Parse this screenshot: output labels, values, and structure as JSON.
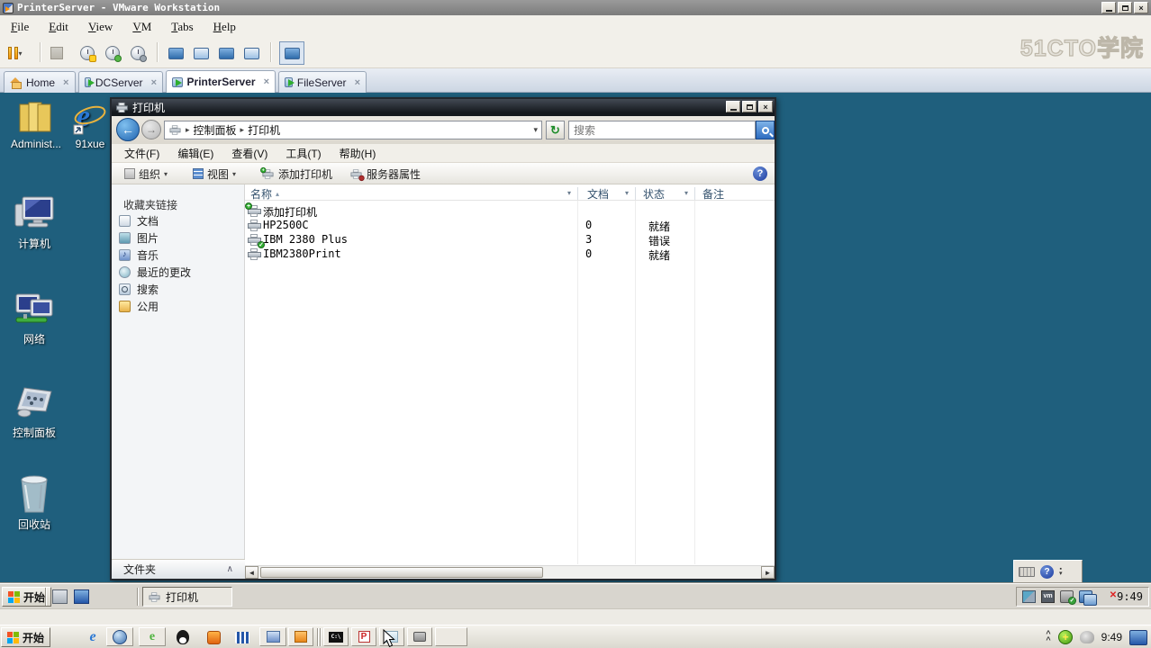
{
  "vmware": {
    "title": "PrinterServer - VMware Workstation",
    "menu_items": [
      "File",
      "Edit",
      "View",
      "VM",
      "Tabs",
      "Help"
    ],
    "toolbar_icons": [
      "pause-icon",
      "ctrl-alt-del-icon",
      "snapshot-take-icon",
      "snapshot-revert-icon",
      "snapshot-manager-icon",
      "console-view-icon",
      "unity-view-icon",
      "fullscreen-icon",
      "show-console-icon",
      "library-toggle-icon"
    ],
    "tabs": [
      {
        "label": "Home"
      },
      {
        "label": "DCServer"
      },
      {
        "label": "PrinterServer"
      },
      {
        "label": "FileServer"
      }
    ],
    "watermark": "51CTO学院"
  },
  "desktop": {
    "bg_color": "#1F5F7D",
    "icons": [
      {
        "label": "Administ..."
      },
      {
        "label": "91xue"
      },
      {
        "label": "计算机"
      },
      {
        "label": "网络"
      },
      {
        "label": "控制面板"
      },
      {
        "label": "回收站"
      }
    ]
  },
  "printer_window": {
    "title": "打印机",
    "breadcrumb": {
      "segment1": "控制面板",
      "segment2": "打印机"
    },
    "search": {
      "placeholder": "搜索"
    },
    "menu_items": [
      "文件(F)",
      "编辑(E)",
      "查看(V)",
      "工具(T)",
      "帮助(H)"
    ],
    "commands": {
      "organize": "组织",
      "views": "视图",
      "add_printer": "添加打印机",
      "server_properties": "服务器属性"
    },
    "sidebar": {
      "header": "收藏夹链接",
      "items": [
        "文档",
        "图片",
        "音乐",
        "最近的更改",
        "搜索",
        "公用"
      ],
      "footer": "文件夹"
    },
    "columns": [
      "名称",
      "文档",
      "状态",
      "备注"
    ],
    "rows": [
      {
        "name": "添加打印机",
        "documents": "",
        "status": "",
        "remark": ""
      },
      {
        "name": "HP2500C",
        "documents": "0",
        "status": "就绪",
        "remark": ""
      },
      {
        "name": "IBM 2380 Plus",
        "documents": "3",
        "status": "错误",
        "remark": ""
      },
      {
        "name": "IBM2380Print",
        "documents": "0",
        "status": "就绪",
        "remark": ""
      }
    ]
  },
  "language_bar": {
    "icons": [
      "keyboard-icon",
      "help-icon",
      "options-icon"
    ]
  },
  "guest_taskbar": {
    "start_label": "开始",
    "quicklaunch_icons": [
      "server-manager-icon",
      "show-desktop-icon"
    ],
    "task_button": "打印机",
    "tray_icons": [
      "vmware-tools-icon",
      "vm-icon",
      "usb-device-icon",
      "network-icon",
      "volume-muted-icon"
    ],
    "clock": "9:49"
  },
  "host_taskbar": {
    "start_label": "开始",
    "quicklaunch_icons": [
      "ie-icon",
      "globe-icon",
      "browser-360-icon",
      "qq-icon",
      "fox-app-icon",
      "film-icon",
      "media-app-icon",
      "orange-app-icon"
    ],
    "task_icons": [
      "cmd-icon",
      "powerpoint-icon",
      "notes-app-icon",
      "tool-app-icon"
    ],
    "tray_icons": [
      "collapse-chevron-icon",
      "antivirus-360-icon",
      "misc-tray-icon",
      "show-desktop-icon"
    ],
    "clock": "9:49"
  },
  "colors": {
    "desktop_bg": "#1F5F7D",
    "guest_titlebar_top": "#434a54",
    "guest_titlebar_bottom": "#14181d",
    "accent_blue": "#2d6cc0",
    "status_ready_error_text": "#000000"
  }
}
